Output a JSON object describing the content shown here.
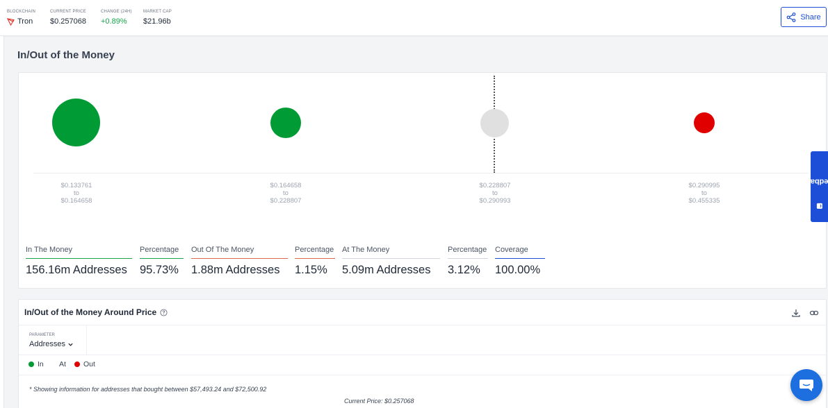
{
  "header": {
    "stats": [
      {
        "label": "BLOCKCHAIN",
        "value": "Tron",
        "icon": "tron-icon"
      },
      {
        "label": "CURRENT PRICE",
        "value": "$0.257068"
      },
      {
        "label": "CHANGE (24H)",
        "value": "+0.89%",
        "color": "#16a34a"
      },
      {
        "label": "MARKET CAP",
        "value": "$21.96b"
      }
    ],
    "share_label": "Share"
  },
  "section_title": "In/Out of the Money",
  "bubbles": [
    {
      "status": "in",
      "color": "#009b34",
      "range_from": "$0.133761",
      "to": "to",
      "range_to": "$0.164658"
    },
    {
      "status": "in",
      "color": "#009b34",
      "range_from": "$0.164658",
      "to": "to",
      "range_to": "$0.228807"
    },
    {
      "status": "at",
      "color": "#e0e0e0",
      "range_from": "$0.228807",
      "to": "to",
      "range_to": "$0.290993"
    },
    {
      "status": "out",
      "color": "#e00000",
      "range_from": "$0.290995",
      "to": "to",
      "range_to": "$0.455335"
    }
  ],
  "metrics": [
    {
      "label": "In The Money",
      "value": "156.16m Addresses",
      "accent": "#16a34a"
    },
    {
      "label": "Percentage",
      "value": "95.73%",
      "accent": "#16a34a"
    },
    {
      "label": "Out Of The Money",
      "value": "1.88m Addresses",
      "accent": "#dc6a4a"
    },
    {
      "label": "Percentage",
      "value": "1.15%",
      "accent": "#dc6a4a"
    },
    {
      "label": "At The Money",
      "value": "5.09m Addresses",
      "accent": "#d1d5db"
    },
    {
      "label": "Percentage",
      "value": "3.12%",
      "accent": "#d1d5db"
    },
    {
      "label": "Coverage",
      "value": "100.00%",
      "accent": "#1d4ed8"
    }
  ],
  "around_price": {
    "title": "In/Out of the Money Around Price",
    "parameter_label": "PARAMETER",
    "parameter_value": "Addresses",
    "legend": [
      {
        "label": "In",
        "color": "#009b34"
      },
      {
        "label": "At",
        "color": ""
      },
      {
        "label": "Out",
        "color": "#e00000"
      }
    ],
    "note": "* Showing information for addresses that bought between $57,493.24 and $72,500.92",
    "current_price": "Current Price: $0.257068"
  },
  "feedback_label": "Feedback"
}
